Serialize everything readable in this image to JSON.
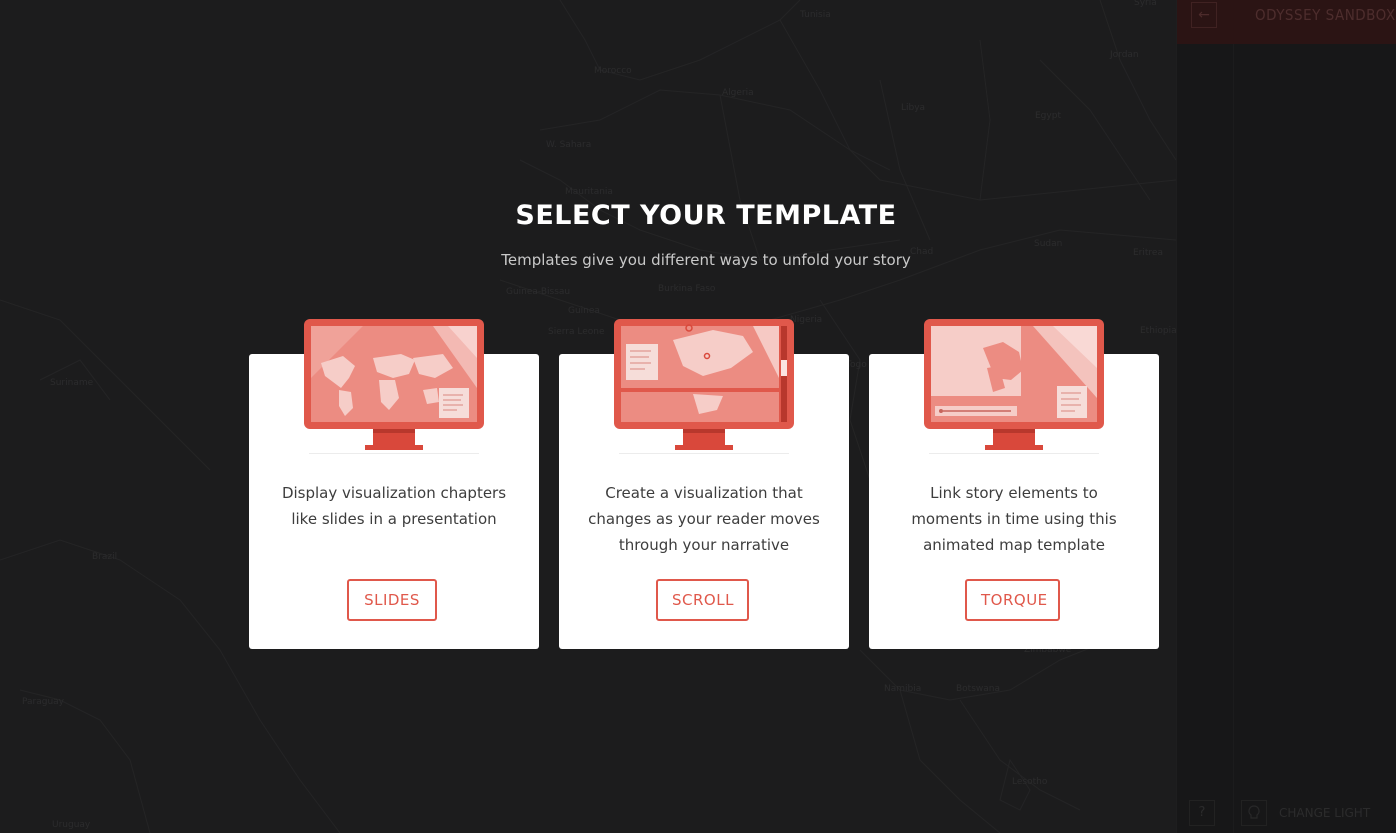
{
  "map": {
    "labels": [
      "Tunisia",
      "Syria",
      "Morocco",
      "Algeria",
      "Libya",
      "Jordan",
      "Egypt",
      "W. Sahara",
      "Mauritania",
      "Chad",
      "Sudan",
      "Eritrea",
      "Guinea-Bissau",
      "Burkina Faso",
      "Guinea",
      "Sierra Leone",
      "Nigeria",
      "Ethiopia",
      "Suriname",
      "Brazil",
      "Paraguay",
      "Uruguay",
      "Namibia",
      "Botswana",
      "Lesotho",
      "Zimbabwe",
      "Togo"
    ]
  },
  "editor": {
    "back_icon": "arrow-left-icon",
    "title": "ODYSSEY SANDBOX",
    "help_label": "?",
    "change_label": "CHANGE LIGHT"
  },
  "modal": {
    "title": "SELECT YOUR TEMPLATE",
    "subtitle": "Templates give you different ways to unfold your story",
    "accent_color": "#e0584b",
    "templates": [
      {
        "icon": "monitor-world-map-icon",
        "description": "Display visualization chapters like slides in a presentation",
        "button": "SLIDES"
      },
      {
        "icon": "monitor-scroll-map-icon",
        "description": "Create a visualization that changes as your reader moves through your narrative",
        "button": "SCROLL"
      },
      {
        "icon": "monitor-timeline-map-icon",
        "description": "Link story elements to moments in time using this animated map template",
        "button": "TORQUE"
      }
    ]
  }
}
